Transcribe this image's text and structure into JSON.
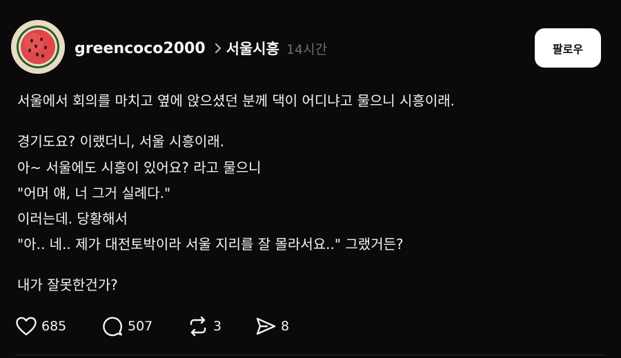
{
  "post": {
    "author": {
      "username": "greencoco2000"
    },
    "community": "서울시흥",
    "time": "14시간",
    "follow_label": "팔로우",
    "lines": [
      "서울에서 회의를 마치고 옆에 앉으셨던 분께 댁이 어디냐고 물으니 시흥이래.",
      "경기도요? 이랬더니, 서울 시흥이래.",
      "아~ 서울에도 시흥이 있어요? 라고 물으니",
      "\"어머 얘, 너 그거 실례다.\"",
      "이러는데. 당황해서",
      "\"아.. 네.. 제가 대전토박이라 서울 지리를 잘 몰라서요..\" 그랬거든?",
      "내가 잘못한건가?"
    ],
    "stats": {
      "likes": "685",
      "comments": "507",
      "reposts": "3",
      "shares": "8"
    }
  },
  "icons": {
    "avatar": "watermelon-avatar",
    "chevron": "chevron-right-icon",
    "like": "heart-icon",
    "comment": "comment-bubble-icon",
    "repost": "repost-icon",
    "share": "send-icon"
  },
  "colors": {
    "background": "#0a0a0a",
    "text": "#f3f5f7",
    "muted": "#6f6f6f",
    "button_bg": "#ffffff"
  }
}
